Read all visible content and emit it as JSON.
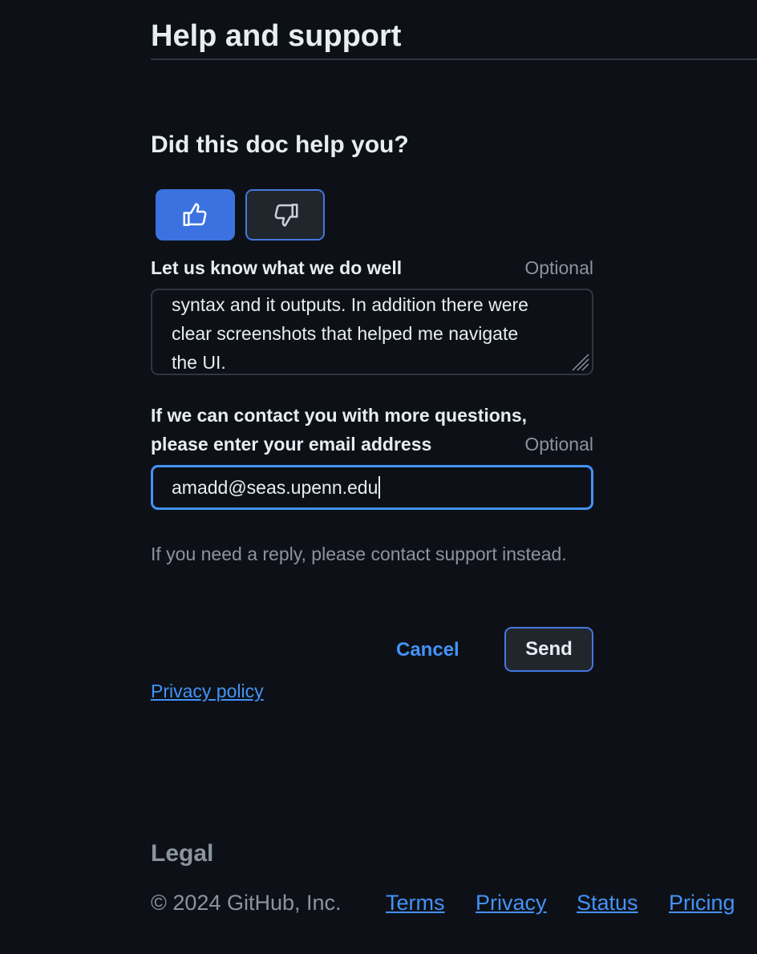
{
  "section": {
    "title": "Help and support"
  },
  "feedback": {
    "question": "Did this doc help you?",
    "vote_yes_icon": "thumbs-up-icon",
    "vote_no_icon": "thumbs-down-icon",
    "selected_vote": "yes",
    "well_label": "Let us know what we do well",
    "well_optional": "Optional",
    "well_text": "syntax and it outputs. In addition there were\nclear screenshots that helped me navigate\nthe UI.",
    "email_label_line1": "If we can contact you with more questions,",
    "email_label_line2": "please enter your email address",
    "email_optional": "Optional",
    "email_value": "amadd@seas.upenn.edu",
    "reply_note": "If you need a reply, please contact support instead.",
    "cancel_label": "Cancel",
    "send_label": "Send",
    "privacy_label": "Privacy policy"
  },
  "footer": {
    "legal_title": "Legal",
    "copyright": "© 2024 GitHub, Inc.",
    "links": [
      "Terms",
      "Privacy",
      "Status",
      "Pricing"
    ]
  },
  "colors": {
    "background": "#0d1117",
    "accent": "#4493f8",
    "selected_vote": "#3b72e0",
    "muted_text": "#8b949e"
  }
}
